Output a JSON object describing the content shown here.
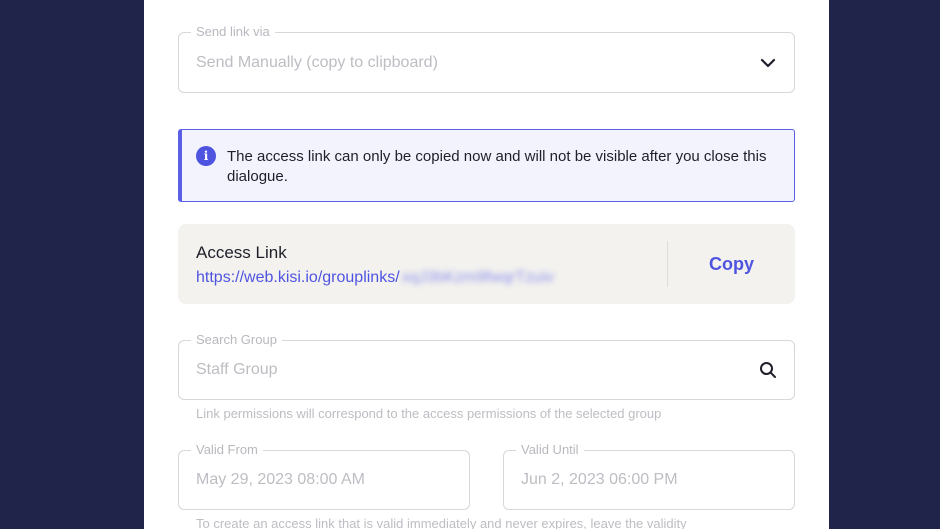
{
  "send_link": {
    "label": "Send link via",
    "value": "Send Manually (copy to clipboard)"
  },
  "info": {
    "message": "The access link can only be copied now and will not be visible after you close this dialogue."
  },
  "access_link": {
    "title": "Access Link",
    "url_prefix": "https://web.kisi.io/grouplinks/",
    "url_token": "xqJ3bKzm9fwqrTzuiv",
    "copy_label": "Copy"
  },
  "search_group": {
    "label": "Search Group",
    "placeholder": "Staff Group",
    "helper": "Link permissions will correspond to the access permissions of the selected group"
  },
  "valid_from": {
    "label": "Valid From",
    "value": "May 29, 2023 08:00 AM"
  },
  "valid_until": {
    "label": "Valid Until",
    "value": "Jun 2, 2023 06:00 PM"
  },
  "validity_helper": "To create an access link that is valid immediately and never expires, leave the validity",
  "colors": {
    "backdrop": "#21244a",
    "accent": "#4f54e0",
    "info_bg": "#f2f3fc",
    "card_bg": "#f3f2ef"
  },
  "icons": {
    "dropdown": "chevron-down-icon",
    "info": "info-icon",
    "search": "search-icon"
  }
}
